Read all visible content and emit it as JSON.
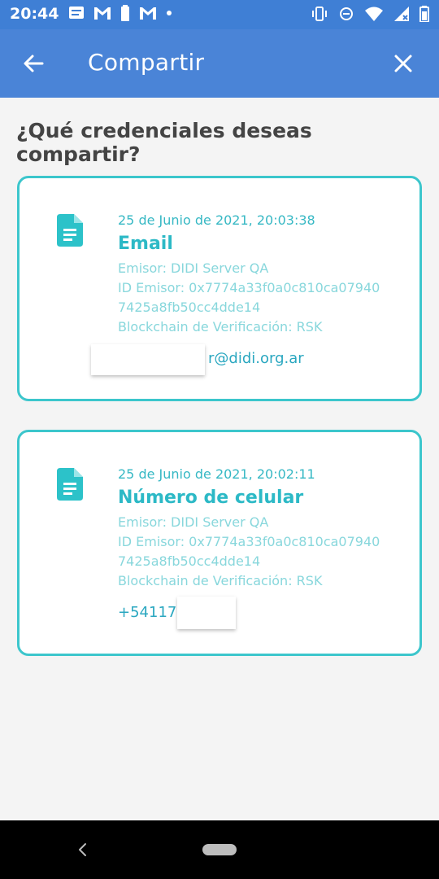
{
  "status_bar": {
    "time": "20:44",
    "left_icons": [
      "message-icon",
      "gmail-icon",
      "battery-saver-icon",
      "gmail-icon",
      "dot-icon"
    ],
    "right_icons": [
      "vibrate-icon",
      "cast-icon",
      "wifi-icon",
      "signal-icon",
      "battery-icon"
    ]
  },
  "app_bar": {
    "title": "Compartir",
    "back_icon": "arrow-left-icon",
    "close_icon": "close-icon",
    "color": "#4a84d7"
  },
  "main": {
    "question": "¿Qué credenciales deseas compartir?",
    "cards": [
      {
        "icon": "document-icon",
        "date": "25 de Junio de 2021, 20:03:38",
        "name": "Email",
        "issuer": "Emisor: DIDI Server QA",
        "issuer_id_line1": "ID Emisor: 0x7774a33f0a0c810ca07940",
        "issuer_id_line2": "7425a8fb50cc4dde14",
        "blockchain": "Blockchain de Verificación: RSK",
        "value": "r@didi.org.ar"
      },
      {
        "icon": "document-icon",
        "date": "25 de Junio de 2021, 20:02:11",
        "name": "Número de celular",
        "issuer": "Emisor: DIDI Server QA",
        "issuer_id_line1": "ID Emisor: 0x7774a33f0a0c810ca07940",
        "issuer_id_line2": "7425a8fb50cc4dde14",
        "blockchain": "Blockchain de Verificación: RSK",
        "value": "+541173"
      }
    ],
    "accent_color": "#3cc6cc"
  },
  "nav_bar": {
    "back_icon": "chevron-left-icon",
    "home_icon": "home-pill-icon"
  }
}
